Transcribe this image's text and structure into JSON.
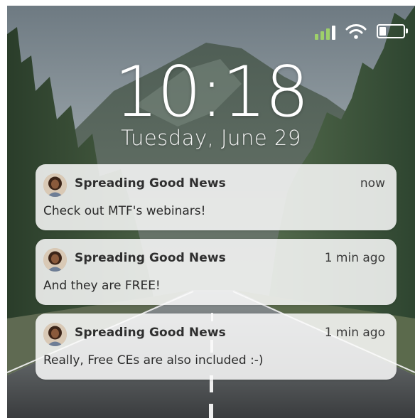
{
  "status_bar": {
    "signal_icon": "cellular-signal-icon",
    "wifi_icon": "wifi-icon",
    "battery_icon": "battery-icon",
    "battery_level": 0.3,
    "signal_color": "#9ed06a"
  },
  "lock_screen": {
    "time": "10:18",
    "date": "Tuesday, June 29"
  },
  "notifications": [
    {
      "app": "Spreading Good News",
      "time": "now",
      "message": "Check out MTF's webinars!",
      "avatar_icon": "profile-avatar"
    },
    {
      "app": "Spreading Good News",
      "time": "1 min ago",
      "message": "And they are FREE!",
      "avatar_icon": "profile-avatar"
    },
    {
      "app": "Spreading Good News",
      "time": "1 min ago",
      "message": "Really, Free CEs are also included :-)",
      "avatar_icon": "profile-avatar"
    }
  ]
}
